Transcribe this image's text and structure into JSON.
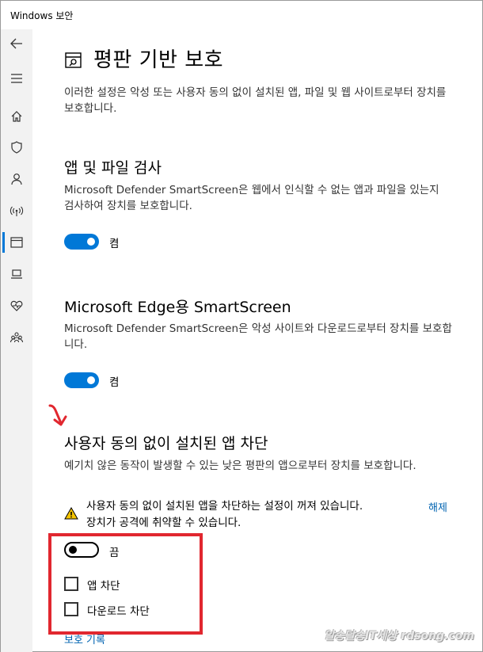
{
  "window": {
    "title": "Windows 보안"
  },
  "sidebar": {
    "items": [
      {
        "name": "back-icon"
      },
      {
        "name": "menu-icon"
      },
      {
        "name": "home-icon"
      },
      {
        "name": "shield-icon"
      },
      {
        "name": "person-icon"
      },
      {
        "name": "network-icon"
      },
      {
        "name": "app-browser-icon",
        "active": true
      },
      {
        "name": "device-icon"
      },
      {
        "name": "heart-icon"
      },
      {
        "name": "family-icon"
      }
    ]
  },
  "page": {
    "title": "평판 기반 보호",
    "description": "이러한 설정은 악성 또는 사용자 동의 없이 설치된 앱, 파일 및 웹 사이트로부터 장치를 보호합니다.",
    "sections": [
      {
        "title": "앱 및 파일 검사",
        "description": "Microsoft Defender SmartScreen은 웹에서 인식할 수 없는 앱과 파일을 있는지 검사하여 장치를 보호합니다.",
        "toggle_state": "켬"
      },
      {
        "title": "Microsoft Edge용 SmartScreen",
        "description": "Microsoft Defender SmartScreen은 악성 사이트와 다운로드로부터 장치를 보호합니다.",
        "toggle_state": "켬"
      },
      {
        "title": "사용자 동의 없이 설치된 앱 차단",
        "description": "예기치 않은 동작이 발생할 수 있는 낮은 평판의 앱으로부터 장치를 보호합니다.",
        "warning_line1": "사용자 동의 없이 설치된 앱을 차단하는 설정이 꺼져 있습니다.",
        "warning_line2": "장치가 공격에 취약할 수 있습니다.",
        "warning_action": "해제",
        "toggle_state": "끔",
        "checkbox_app": "앱 차단",
        "checkbox_download": "다운로드 차단",
        "history_link": "보호 기록"
      }
    ]
  },
  "colors": {
    "accent": "#0078d7",
    "annotation": "#e1272f",
    "warning": "#f5c400"
  },
  "watermark": "알송달송IT세상 rdsong.com"
}
